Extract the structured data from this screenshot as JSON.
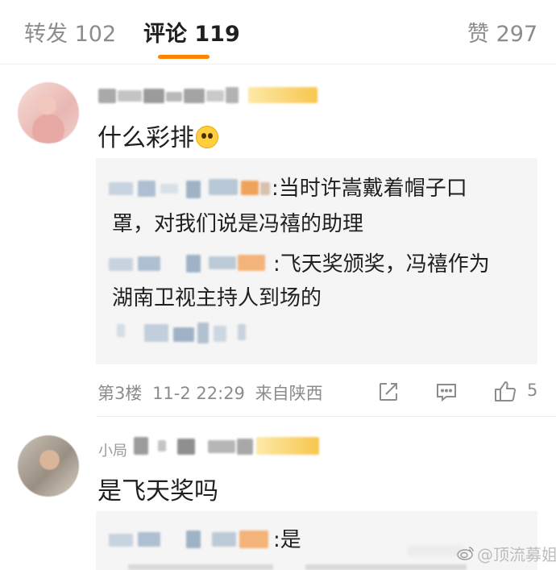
{
  "tabs": {
    "repost": "转发 102",
    "comments": "评论 119",
    "likes": "赞 297"
  },
  "comments": [
    {
      "text": "什么彩排",
      "replies": [
        {
          "line1": "当时许嵩戴着帽子口",
          "line2": "罩，对我们说是冯禧的助理"
        },
        {
          "line1": "飞天奖颁奖，冯禧作为",
          "line2": "湖南卫视主持人到场的"
        }
      ],
      "reply_colons": [
        ":",
        ":"
      ],
      "floor": "第3楼",
      "time": "11-2 22:29",
      "location": "来自陕西",
      "like_count": "5"
    },
    {
      "username_visible": "小局",
      "text": "是飞天奖吗",
      "replies": [
        {
          "line1": "是"
        }
      ],
      "reply_colon": ":"
    }
  ],
  "watermark": {
    "text": "@顶流募姐"
  },
  "colors": {
    "accent": "#ff8200",
    "muted": "#8c8c8c",
    "reply_bg": "#f5f5f5"
  },
  "icons": [
    "share-icon",
    "reply-icon",
    "like-icon",
    "weibo-icon"
  ]
}
